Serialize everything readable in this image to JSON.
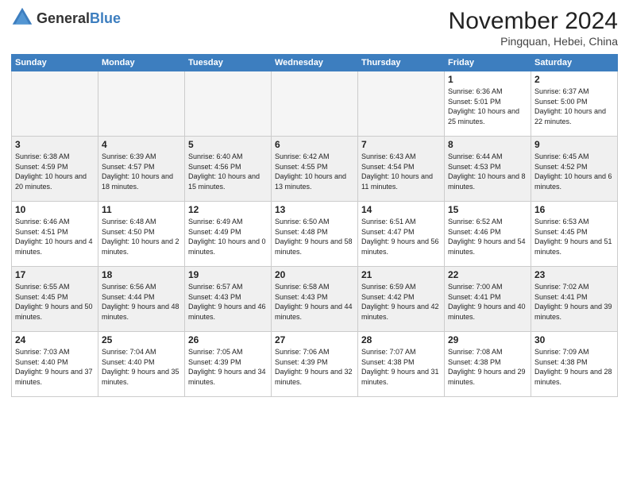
{
  "logo": {
    "general": "General",
    "blue": "Blue"
  },
  "title": "November 2024",
  "location": "Pingquan, Hebei, China",
  "days_of_week": [
    "Sunday",
    "Monday",
    "Tuesday",
    "Wednesday",
    "Thursday",
    "Friday",
    "Saturday"
  ],
  "weeks": [
    [
      {
        "day": "",
        "info": ""
      },
      {
        "day": "",
        "info": ""
      },
      {
        "day": "",
        "info": ""
      },
      {
        "day": "",
        "info": ""
      },
      {
        "day": "",
        "info": ""
      },
      {
        "day": "1",
        "info": "Sunrise: 6:36 AM\nSunset: 5:01 PM\nDaylight: 10 hours and 25 minutes."
      },
      {
        "day": "2",
        "info": "Sunrise: 6:37 AM\nSunset: 5:00 PM\nDaylight: 10 hours and 22 minutes."
      }
    ],
    [
      {
        "day": "3",
        "info": "Sunrise: 6:38 AM\nSunset: 4:59 PM\nDaylight: 10 hours and 20 minutes."
      },
      {
        "day": "4",
        "info": "Sunrise: 6:39 AM\nSunset: 4:57 PM\nDaylight: 10 hours and 18 minutes."
      },
      {
        "day": "5",
        "info": "Sunrise: 6:40 AM\nSunset: 4:56 PM\nDaylight: 10 hours and 15 minutes."
      },
      {
        "day": "6",
        "info": "Sunrise: 6:42 AM\nSunset: 4:55 PM\nDaylight: 10 hours and 13 minutes."
      },
      {
        "day": "7",
        "info": "Sunrise: 6:43 AM\nSunset: 4:54 PM\nDaylight: 10 hours and 11 minutes."
      },
      {
        "day": "8",
        "info": "Sunrise: 6:44 AM\nSunset: 4:53 PM\nDaylight: 10 hours and 8 minutes."
      },
      {
        "day": "9",
        "info": "Sunrise: 6:45 AM\nSunset: 4:52 PM\nDaylight: 10 hours and 6 minutes."
      }
    ],
    [
      {
        "day": "10",
        "info": "Sunrise: 6:46 AM\nSunset: 4:51 PM\nDaylight: 10 hours and 4 minutes."
      },
      {
        "day": "11",
        "info": "Sunrise: 6:48 AM\nSunset: 4:50 PM\nDaylight: 10 hours and 2 minutes."
      },
      {
        "day": "12",
        "info": "Sunrise: 6:49 AM\nSunset: 4:49 PM\nDaylight: 10 hours and 0 minutes."
      },
      {
        "day": "13",
        "info": "Sunrise: 6:50 AM\nSunset: 4:48 PM\nDaylight: 9 hours and 58 minutes."
      },
      {
        "day": "14",
        "info": "Sunrise: 6:51 AM\nSunset: 4:47 PM\nDaylight: 9 hours and 56 minutes."
      },
      {
        "day": "15",
        "info": "Sunrise: 6:52 AM\nSunset: 4:46 PM\nDaylight: 9 hours and 54 minutes."
      },
      {
        "day": "16",
        "info": "Sunrise: 6:53 AM\nSunset: 4:45 PM\nDaylight: 9 hours and 51 minutes."
      }
    ],
    [
      {
        "day": "17",
        "info": "Sunrise: 6:55 AM\nSunset: 4:45 PM\nDaylight: 9 hours and 50 minutes."
      },
      {
        "day": "18",
        "info": "Sunrise: 6:56 AM\nSunset: 4:44 PM\nDaylight: 9 hours and 48 minutes."
      },
      {
        "day": "19",
        "info": "Sunrise: 6:57 AM\nSunset: 4:43 PM\nDaylight: 9 hours and 46 minutes."
      },
      {
        "day": "20",
        "info": "Sunrise: 6:58 AM\nSunset: 4:43 PM\nDaylight: 9 hours and 44 minutes."
      },
      {
        "day": "21",
        "info": "Sunrise: 6:59 AM\nSunset: 4:42 PM\nDaylight: 9 hours and 42 minutes."
      },
      {
        "day": "22",
        "info": "Sunrise: 7:00 AM\nSunset: 4:41 PM\nDaylight: 9 hours and 40 minutes."
      },
      {
        "day": "23",
        "info": "Sunrise: 7:02 AM\nSunset: 4:41 PM\nDaylight: 9 hours and 39 minutes."
      }
    ],
    [
      {
        "day": "24",
        "info": "Sunrise: 7:03 AM\nSunset: 4:40 PM\nDaylight: 9 hours and 37 minutes."
      },
      {
        "day": "25",
        "info": "Sunrise: 7:04 AM\nSunset: 4:40 PM\nDaylight: 9 hours and 35 minutes."
      },
      {
        "day": "26",
        "info": "Sunrise: 7:05 AM\nSunset: 4:39 PM\nDaylight: 9 hours and 34 minutes."
      },
      {
        "day": "27",
        "info": "Sunrise: 7:06 AM\nSunset: 4:39 PM\nDaylight: 9 hours and 32 minutes."
      },
      {
        "day": "28",
        "info": "Sunrise: 7:07 AM\nSunset: 4:38 PM\nDaylight: 9 hours and 31 minutes."
      },
      {
        "day": "29",
        "info": "Sunrise: 7:08 AM\nSunset: 4:38 PM\nDaylight: 9 hours and 29 minutes."
      },
      {
        "day": "30",
        "info": "Sunrise: 7:09 AM\nSunset: 4:38 PM\nDaylight: 9 hours and 28 minutes."
      }
    ]
  ]
}
